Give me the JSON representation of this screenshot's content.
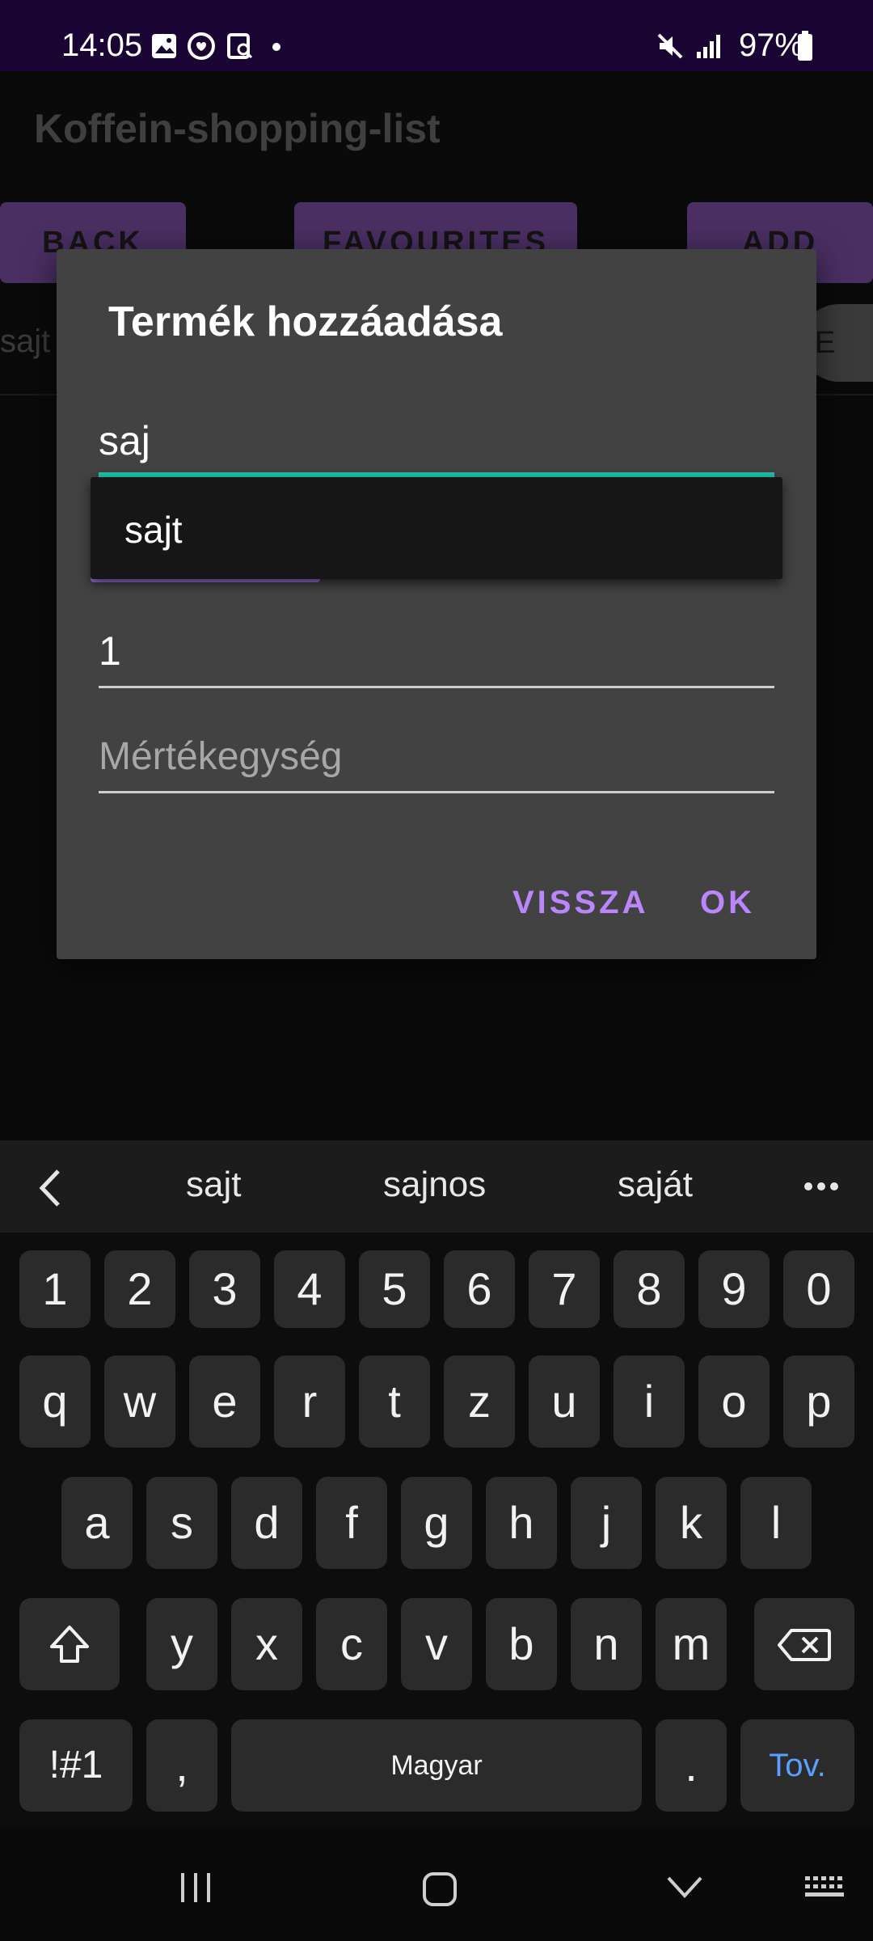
{
  "status_bar": {
    "time": "14:05",
    "battery": "97%",
    "icons": [
      "image-icon",
      "messenger-icon",
      "screen-search-icon",
      "dot-icon",
      "mute-icon",
      "signal-icon",
      "battery-icon"
    ]
  },
  "app": {
    "title": "Koffein-shopping-list",
    "buttons": [
      "BACK",
      "FAVOURITES",
      "ADD"
    ],
    "list_item": "sajt",
    "pill_label": "E"
  },
  "dialog": {
    "title": "Termék hozzáadása",
    "name_value": "saj",
    "quantity_value": "1",
    "unit_placeholder": "Mértékegység",
    "cancel_label": "VISSZA",
    "ok_label": "OK"
  },
  "autocomplete": {
    "items": [
      "sajt"
    ]
  },
  "keyboard": {
    "suggestions": [
      "sajt",
      "sajnos",
      "saját"
    ],
    "row_numbers": [
      "1",
      "2",
      "3",
      "4",
      "5",
      "6",
      "7",
      "8",
      "9",
      "0"
    ],
    "row_1": [
      "q",
      "w",
      "e",
      "r",
      "t",
      "z",
      "u",
      "i",
      "o",
      "p"
    ],
    "row_2": [
      "a",
      "s",
      "d",
      "f",
      "g",
      "h",
      "j",
      "k",
      "l"
    ],
    "row_3": [
      "y",
      "x",
      "c",
      "v",
      "b",
      "n",
      "m"
    ],
    "symbols_key": "!#1",
    "comma_key": ",",
    "space_key": "Magyar",
    "period_key": ".",
    "enter_key": "Tov.",
    "colors": {
      "enter_text": "#5aa0ff",
      "accent": "#bb86fc",
      "active_underline": "#1fbfa7"
    }
  }
}
